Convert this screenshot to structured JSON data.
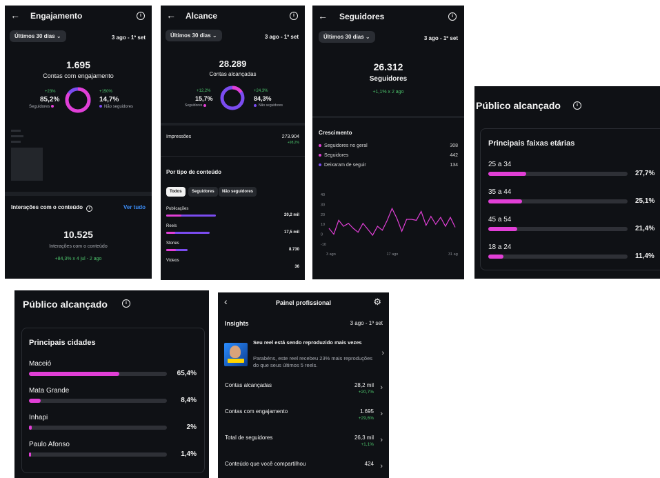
{
  "engajamento": {
    "title": "Engajamento",
    "period_select": "Últimos 30 dias",
    "date_range": "3 ago - 1º set",
    "total": "1.695",
    "total_label": "Contas com engajamento",
    "followers_change": "+23%",
    "followers_pct": "85,2%",
    "followers_label": "Seguidores",
    "nonfollowers_change": "+150%",
    "nonfollowers_pct": "14,7%",
    "nonfollowers_label": "Não seguidores",
    "donut_followers_fraction": 0.852,
    "interactions_title": "Interações com o conteúdo",
    "see_all": "Ver tudo",
    "interactions_total": "10.525",
    "interactions_label": "Interações com o conteúdo",
    "interactions_change": "+84,3% x 4 jul - 2 ago"
  },
  "alcance": {
    "title": "Alcance",
    "period_select": "Últimos 30 dias",
    "date_range": "3 ago - 1º set",
    "total": "28.289",
    "total_label": "Contas alcançadas",
    "followers_change": "+12,2%",
    "followers_pct": "15,7%",
    "followers_label": "Seguidores",
    "nonfollowers_change": "+24,3%",
    "nonfollowers_pct": "84,3%",
    "nonfollowers_label": "Não seguidores",
    "donut_followers_fraction": 0.157,
    "impressions_label": "Impressões",
    "impressions_value": "273.904",
    "impressions_change": "+98,2%",
    "content_type_title": "Por tipo de conteúdo",
    "filters": [
      "Todos",
      "Seguidores",
      "Não seguidores"
    ],
    "content_rows": [
      {
        "label": "Publicações",
        "value": "20,2 mil",
        "fraction": 0.63,
        "followers_share": 0.3
      },
      {
        "label": "Reels",
        "value": "17,5 mil",
        "fraction": 0.55,
        "followers_share": 0.2
      },
      {
        "label": "Stories",
        "value": "8.730",
        "fraction": 0.27,
        "followers_share": 0.45
      },
      {
        "label": "Vídeos",
        "value": "36",
        "fraction": 0.0,
        "followers_share": 0.0
      }
    ]
  },
  "seguidores": {
    "title": "Seguidores",
    "period_select": "Últimos 30 dias",
    "date_range": "3 ago - 1º set",
    "total": "26.312",
    "total_label": "Seguidores",
    "change": "+1,1% x 2 ago",
    "growth_title": "Crescimento",
    "growth_rows": [
      {
        "label": "Seguidores no geral",
        "value": "308",
        "color": "#e13fd6"
      },
      {
        "label": "Seguidores",
        "value": "442",
        "color": "#e13fd6"
      },
      {
        "label": "Deixaram de seguir",
        "value": "134",
        "color": "#7b4cf0"
      }
    ],
    "chart_data": {
      "type": "line",
      "x_tick_labels": [
        "3 ago",
        "17 ago",
        "31 ag"
      ],
      "y_ticks": [
        -10,
        0,
        10,
        20,
        30,
        40
      ],
      "ylim": [
        -10,
        40
      ],
      "series": [
        {
          "values": [
            6,
            0,
            14,
            8,
            11,
            6,
            2,
            11,
            5,
            -1,
            8,
            4,
            14,
            26,
            16,
            3,
            15,
            15,
            14,
            23,
            9,
            18,
            10,
            17,
            8,
            17,
            7
          ]
        }
      ]
    }
  },
  "faixas": {
    "title": "Público alcançado",
    "card_title": "Principais faixas etárias",
    "rows": [
      {
        "label": "25 a 34",
        "value": "27,7%",
        "fraction": 0.277
      },
      {
        "label": "35 a 44",
        "value": "25,1%",
        "fraction": 0.251
      },
      {
        "label": "45 a 54",
        "value": "21,4%",
        "fraction": 0.214
      },
      {
        "label": "18 a 24",
        "value": "11,4%",
        "fraction": 0.114
      }
    ]
  },
  "cidades": {
    "title": "Público alcançado",
    "card_title": "Principais cidades",
    "rows": [
      {
        "label": "Maceió",
        "value": "65,4%",
        "fraction": 0.654
      },
      {
        "label": "Mata Grande",
        "value": "8,4%",
        "fraction": 0.084
      },
      {
        "label": "Inhapi",
        "value": "2%",
        "fraction": 0.02
      },
      {
        "label": "Paulo Afonso",
        "value": "1,4%",
        "fraction": 0.014
      }
    ]
  },
  "painel": {
    "title": "Painel profissional",
    "insights_label": "Insights",
    "date_range": "3 ago - 1º set",
    "reel_title": "Seu reel está sendo reproduzido mais vezes",
    "reel_body": "Parabéns, este reel recebeu 23% mais reproduções do que seus últimos 5 reels.",
    "rows": [
      {
        "label": "Contas alcançadas",
        "value": "28,2 mil",
        "change": "+20,7%"
      },
      {
        "label": "Contas com engajamento",
        "value": "1.695",
        "change": "+29,6%"
      },
      {
        "label": "Total de seguidores",
        "value": "26,3 mil",
        "change": "+1,1%"
      },
      {
        "label": "Conteúdo que você compartilhou",
        "value": "424",
        "change": ""
      }
    ]
  },
  "colors": {
    "pink": "#e13fd6",
    "purple": "#7b4cf0",
    "green": "#4cc36b",
    "link": "#3b8cf6"
  }
}
